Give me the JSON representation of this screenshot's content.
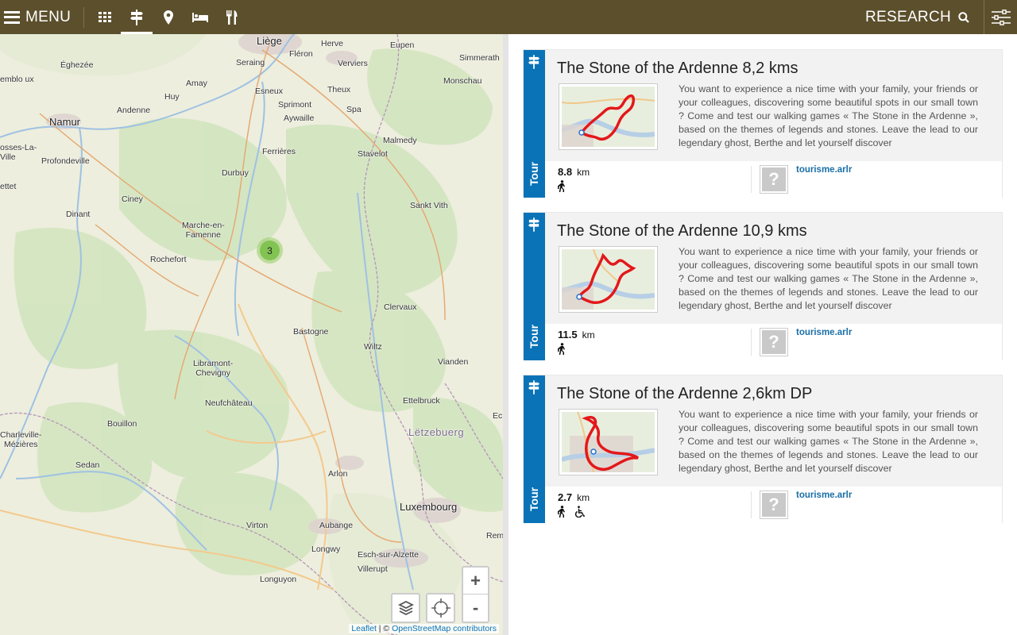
{
  "header": {
    "menu_label": "MENU",
    "nav_icons": [
      "grid-icon",
      "signpost-icon",
      "map-pin-icon",
      "bed-icon",
      "cutlery-icon"
    ],
    "active_nav": "signpost-icon",
    "research_label": "RESEARCH",
    "filter_icon": "sliders-icon"
  },
  "colors": {
    "topbar": "#5b4f2c",
    "accent_blue": "#0a73b7",
    "card_bg": "#f2f2f2",
    "cluster_green": "#78be46",
    "route_red": "#e3181b"
  },
  "map": {
    "towns": {
      "liege": "Liège",
      "herve": "Herve",
      "eupen": "Eupen",
      "simmerath": "Simmerath",
      "eghezee": "Éghezée",
      "seraing": "Seraing",
      "fleron": "Fléron",
      "verviers": "Verviers",
      "monschau": "Monschau",
      "jemeppe": "emblo ux",
      "amay": "Amay",
      "esneux": "Esneux",
      "theux": "Theux",
      "huy": "Huy",
      "sprimont": "Sprimont",
      "namur": "Namur",
      "andenne": "Andenne",
      "aywaille": "Aywaille",
      "spa": "Spa",
      "malmedy": "Malmedy",
      "fosses": "osses-La-\nVille",
      "ferrieres": "Ferrières",
      "stavelot": "Stavelot",
      "profondeville": "Profondeville",
      "durbuy": "Durbuy",
      "ettet": "ettet",
      "ciney": "Ciney",
      "sankt_vith": "Sankt Vith",
      "dinant": "Dinant",
      "marche": "Marche-en-\nFamenne",
      "rochefort": "Rochefort",
      "clervaux": "Clervaux",
      "bastogne": "Bastogne",
      "wiltz": "Wiltz",
      "libramont": "Libramont-\nChevigny",
      "vianden": "Vianden",
      "neufchateau": "Neufchâteau",
      "ettelbruck": "Ettelbruck",
      "letzebuerg": "Lëtzebuerg",
      "ec": "Ec",
      "bouillon": "Bouillon",
      "charleville": "Charleville-\nMézières",
      "sedan": "Sedan",
      "arlon": "Arlon",
      "luxembourg": "Luxembourg",
      "virton": "Virton",
      "aubange": "Aubange",
      "rem": "Rem",
      "longwy": "Longwy",
      "esch": "Esch-sur-Alzette",
      "villerupt": "Villerupt",
      "longuyon": "Longuyon"
    },
    "cluster_count": "3",
    "zoom_in": "+",
    "zoom_out": "-",
    "layers_icon": "layers-icon",
    "locate_icon": "crosshair-icon",
    "attribution": {
      "leaflet": "Leaflet",
      "separator": " | © ",
      "osm": "OpenStreetMap contributors"
    }
  },
  "results": [
    {
      "category": "Tour",
      "title": "The Stone of the Ardenne 8,2 kms",
      "description": "You want to experience a nice time with your family, your friends or your colleagues, discovering some beautiful spots in our small town ? Come and test our walking games « The Stone in the Ardenne », based on the themes of legends and stones. Leave the lead to our legendary ghost, Berthe and let yourself discover",
      "distance": "8.8",
      "unit": "km",
      "activities": [
        "walking-icon"
      ],
      "source": "tourisme.arlr",
      "placeholder": "?"
    },
    {
      "category": "Tour",
      "title": "The Stone of the Ardenne 10,9 kms",
      "description": "You want to experience a nice time with your family, your friends or your colleagues, discovering some beautiful spots in our small town ? Come and test our walking games « The Stone in the Ardenne », based on the themes of legends and stones. Leave the lead to our legendary ghost, Berthe and let yourself discover",
      "distance": "11.5",
      "unit": "km",
      "activities": [
        "walking-icon"
      ],
      "source": "tourisme.arlr",
      "placeholder": "?"
    },
    {
      "category": "Tour",
      "title": "The Stone of the Ardenne 2,6km DP",
      "description": "You want to experience a nice time with your family, your friends or your colleagues, discovering some beautiful spots in our small town ? Come and test our walking games « The Stone in the Ardenne », based on the themes of legends and stones. Leave the lead to our legendary ghost, Berthe and let yourself discover",
      "distance": "2.7",
      "unit": "km",
      "activities": [
        "walking-icon",
        "wheelchair-icon"
      ],
      "source": "tourisme.arlr",
      "placeholder": "?"
    }
  ]
}
